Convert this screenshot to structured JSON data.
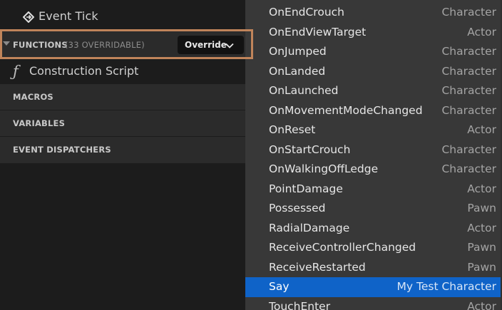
{
  "left_panel": {
    "event_tick": {
      "label": "Event Tick",
      "icon": "event-diamond-icon"
    },
    "functions": {
      "label": "FUNCTIONS",
      "count": "(33 OVERRIDABLE)",
      "override_label": "Override",
      "highlight_color": "#c0845a"
    },
    "construction_script": {
      "label": "Construction Script",
      "icon": "function-f-icon",
      "icon_glyph": "ƒ"
    },
    "sections": [
      {
        "label": "MACROS"
      },
      {
        "label": "VARIABLES"
      },
      {
        "label": "EVENT DISPATCHERS"
      }
    ]
  },
  "override_menu": {
    "items": [
      {
        "name": "OnEndCrouch",
        "owner": "Character"
      },
      {
        "name": "OnEndViewTarget",
        "owner": "Actor"
      },
      {
        "name": "OnJumped",
        "owner": "Character"
      },
      {
        "name": "OnLanded",
        "owner": "Character"
      },
      {
        "name": "OnLaunched",
        "owner": "Character"
      },
      {
        "name": "OnMovementModeChanged",
        "owner": "Character"
      },
      {
        "name": "OnReset",
        "owner": "Actor"
      },
      {
        "name": "OnStartCrouch",
        "owner": "Character"
      },
      {
        "name": "OnWalkingOffLedge",
        "owner": "Character"
      },
      {
        "name": "PointDamage",
        "owner": "Actor"
      },
      {
        "name": "Possessed",
        "owner": "Pawn"
      },
      {
        "name": "RadialDamage",
        "owner": "Actor"
      },
      {
        "name": "ReceiveControllerChanged",
        "owner": "Pawn"
      },
      {
        "name": "ReceiveRestarted",
        "owner": "Pawn"
      },
      {
        "name": "Say",
        "owner": "My Test Character"
      },
      {
        "name": "TouchEnter",
        "owner": "Actor"
      }
    ],
    "selected": "Say",
    "selected_color": "#0f63c8"
  }
}
